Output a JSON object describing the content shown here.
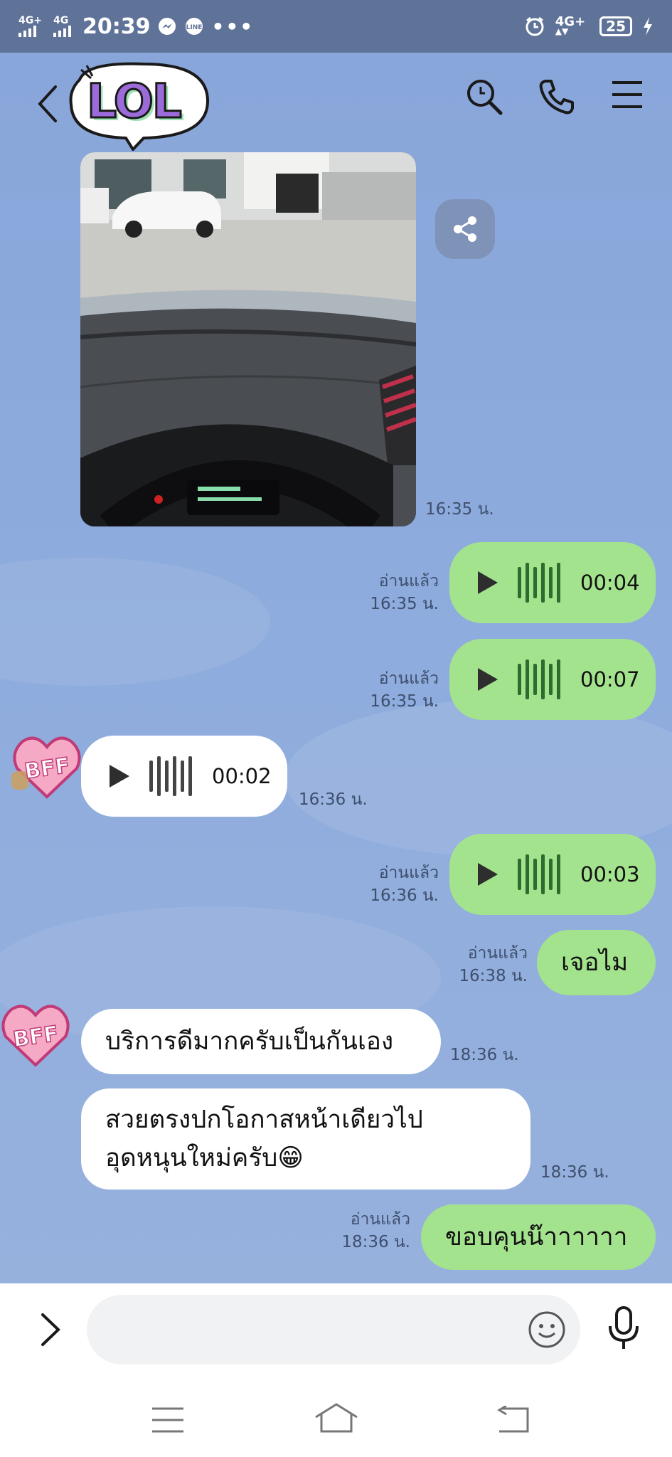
{
  "status": {
    "network1": "4G+",
    "network2": "4G",
    "clock": "20:39",
    "network3": "4G+",
    "battery": "25"
  },
  "header": {
    "sticker_text": "LOL"
  },
  "messages": [
    {
      "id": "photo",
      "type": "image",
      "time": "16:35 น."
    },
    {
      "id": "v1",
      "type": "voice",
      "from": "me",
      "duration": "00:04",
      "read": "อ่านแล้ว",
      "time": "16:35 น."
    },
    {
      "id": "v2",
      "type": "voice",
      "from": "me",
      "duration": "00:07",
      "read": "อ่านแล้ว",
      "time": "16:35 น."
    },
    {
      "id": "v3",
      "type": "voice",
      "from": "other",
      "duration": "00:02",
      "time": "16:36 น."
    },
    {
      "id": "v4",
      "type": "voice",
      "from": "me",
      "duration": "00:03",
      "read": "อ่านแล้ว",
      "time": "16:36 น."
    },
    {
      "id": "t1",
      "type": "text",
      "from": "me",
      "text": "เจอไม",
      "read": "อ่านแล้ว",
      "time": "16:38 น."
    },
    {
      "id": "t2",
      "type": "text",
      "from": "other",
      "text": "บริการดีมากครับเป็นกันเอง",
      "time": "18:36 น."
    },
    {
      "id": "t3",
      "type": "text",
      "from": "other",
      "line1": "สวยตรงปกโอกาสหน้าเดียวไป",
      "line2": "อุดหนุนใหม่ครับ😁",
      "time": "18:36 น."
    },
    {
      "id": "t4",
      "type": "text",
      "from": "me",
      "text": "ขอบคุนน๊าาาาาา",
      "read": "อ่านแล้ว",
      "time": "18:36 น."
    }
  ],
  "avatar_text": "BFF",
  "input": {
    "placeholder": ""
  },
  "colors": {
    "chat_bg": "#8FA9D8",
    "my_bubble": "#A4E38E",
    "other_bubble": "#FFFFFF",
    "status_bar": "#5F7398"
  }
}
